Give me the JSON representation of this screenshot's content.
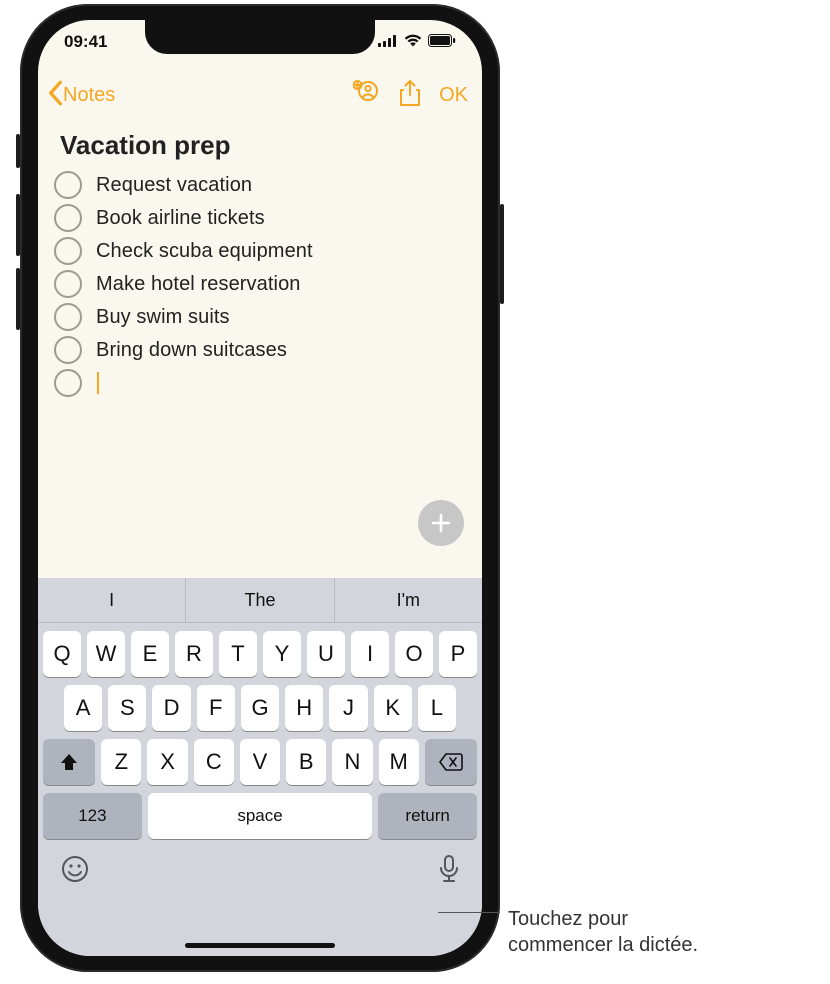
{
  "status": {
    "time": "09:41"
  },
  "nav": {
    "back": "Notes",
    "ok": "OK"
  },
  "note": {
    "title": "Vacation prep",
    "items": [
      "Request vacation",
      "Book airline tickets",
      "Check scuba equipment",
      "Make hotel reservation",
      "Buy swim suits",
      "Bring down suitcases"
    ]
  },
  "keyboard": {
    "suggestions": [
      "I",
      "The",
      "I'm"
    ],
    "row1": [
      "Q",
      "W",
      "E",
      "R",
      "T",
      "Y",
      "U",
      "I",
      "O",
      "P"
    ],
    "row2": [
      "A",
      "S",
      "D",
      "F",
      "G",
      "H",
      "J",
      "K",
      "L"
    ],
    "row3": [
      "Z",
      "X",
      "C",
      "V",
      "B",
      "N",
      "M"
    ],
    "numeric": "123",
    "space": "space",
    "return": "return"
  },
  "callout": {
    "line1": "Touchez pour",
    "line2": "commencer la dictée."
  }
}
